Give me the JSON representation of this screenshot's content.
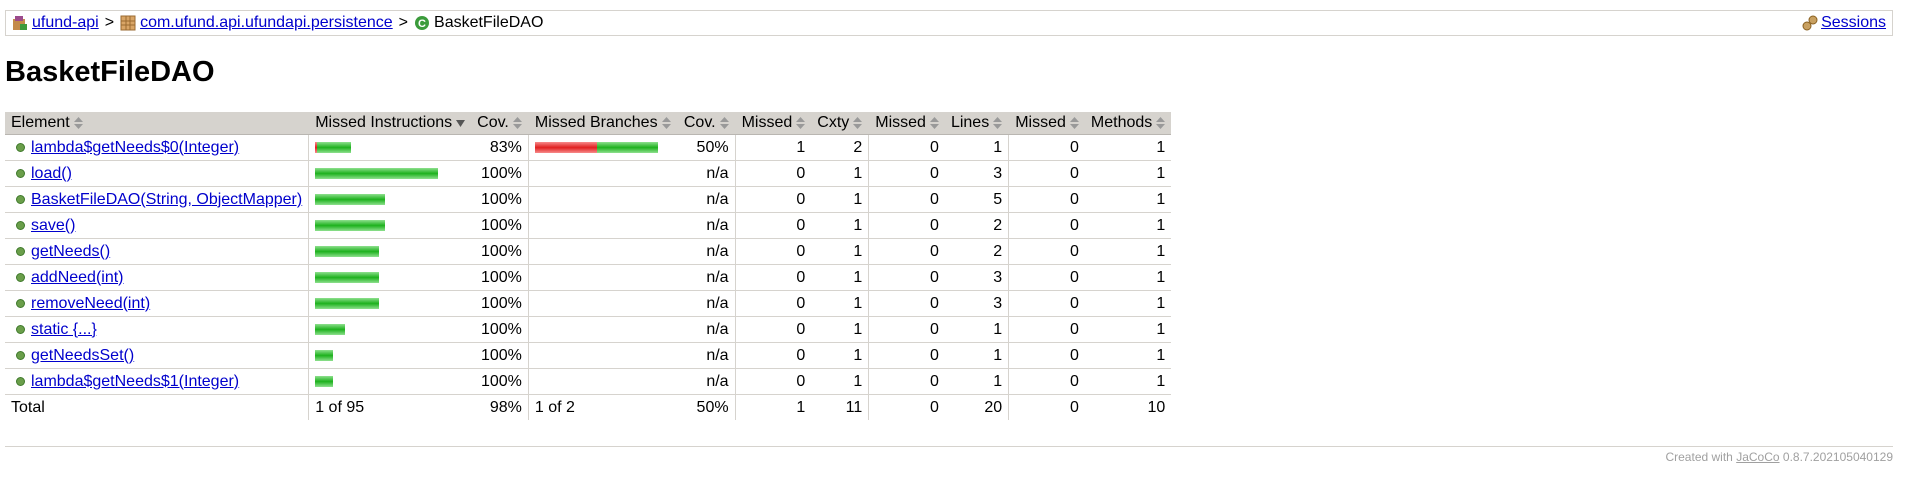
{
  "breadcrumb": {
    "items": [
      {
        "label": "ufund-api",
        "icon": "report-icon"
      },
      {
        "label": "com.ufund.api.ufundapi.persistence",
        "icon": "package-icon"
      }
    ],
    "separator": ">",
    "current": "BasketFileDAO",
    "current_icon": "class-icon",
    "sessions_label": "Sessions"
  },
  "page_title": "BasketFileDAO",
  "table": {
    "headers": [
      "Element",
      "Missed Instructions",
      "Cov.",
      "Missed Branches",
      "Cov.",
      "Missed",
      "Cxty",
      "Missed",
      "Lines",
      "Missed",
      "Methods"
    ],
    "rows": [
      {
        "element": "lambda$getNeeds$0(Integer)",
        "instr_missed_frac": 0.05,
        "instr_width_frac": 0.29,
        "instr_cov": "83%",
        "branch_missed_frac": 0.5,
        "branch_width_frac": 1.0,
        "branch_cov": "50%",
        "cxty_missed": "1",
        "cxty": "2",
        "lines_missed": "0",
        "lines": "1",
        "methods_missed": "0",
        "methods": "1"
      },
      {
        "element": "load()",
        "instr_missed_frac": 0,
        "instr_width_frac": 1.0,
        "instr_cov": "100%",
        "branch_missed_frac": null,
        "branch_width_frac": 0,
        "branch_cov": "n/a",
        "cxty_missed": "0",
        "cxty": "1",
        "lines_missed": "0",
        "lines": "3",
        "methods_missed": "0",
        "methods": "1"
      },
      {
        "element": "BasketFileDAO(String, ObjectMapper)",
        "instr_missed_frac": 0,
        "instr_width_frac": 0.57,
        "instr_cov": "100%",
        "branch_missed_frac": null,
        "branch_width_frac": 0,
        "branch_cov": "n/a",
        "cxty_missed": "0",
        "cxty": "1",
        "lines_missed": "0",
        "lines": "5",
        "methods_missed": "0",
        "methods": "1"
      },
      {
        "element": "save()",
        "instr_missed_frac": 0,
        "instr_width_frac": 0.57,
        "instr_cov": "100%",
        "branch_missed_frac": null,
        "branch_width_frac": 0,
        "branch_cov": "n/a",
        "cxty_missed": "0",
        "cxty": "1",
        "lines_missed": "0",
        "lines": "2",
        "methods_missed": "0",
        "methods": "1"
      },
      {
        "element": "getNeeds()",
        "instr_missed_frac": 0,
        "instr_width_frac": 0.52,
        "instr_cov": "100%",
        "branch_missed_frac": null,
        "branch_width_frac": 0,
        "branch_cov": "n/a",
        "cxty_missed": "0",
        "cxty": "1",
        "lines_missed": "0",
        "lines": "2",
        "methods_missed": "0",
        "methods": "1"
      },
      {
        "element": "addNeed(int)",
        "instr_missed_frac": 0,
        "instr_width_frac": 0.52,
        "instr_cov": "100%",
        "branch_missed_frac": null,
        "branch_width_frac": 0,
        "branch_cov": "n/a",
        "cxty_missed": "0",
        "cxty": "1",
        "lines_missed": "0",
        "lines": "3",
        "methods_missed": "0",
        "methods": "1"
      },
      {
        "element": "removeNeed(int)",
        "instr_missed_frac": 0,
        "instr_width_frac": 0.52,
        "instr_cov": "100%",
        "branch_missed_frac": null,
        "branch_width_frac": 0,
        "branch_cov": "n/a",
        "cxty_missed": "0",
        "cxty": "1",
        "lines_missed": "0",
        "lines": "3",
        "methods_missed": "0",
        "methods": "1"
      },
      {
        "element": "static {...}",
        "instr_missed_frac": 0,
        "instr_width_frac": 0.24,
        "instr_cov": "100%",
        "branch_missed_frac": null,
        "branch_width_frac": 0,
        "branch_cov": "n/a",
        "cxty_missed": "0",
        "cxty": "1",
        "lines_missed": "0",
        "lines": "1",
        "methods_missed": "0",
        "methods": "1"
      },
      {
        "element": "getNeedsSet()",
        "instr_missed_frac": 0,
        "instr_width_frac": 0.15,
        "instr_cov": "100%",
        "branch_missed_frac": null,
        "branch_width_frac": 0,
        "branch_cov": "n/a",
        "cxty_missed": "0",
        "cxty": "1",
        "lines_missed": "0",
        "lines": "1",
        "methods_missed": "0",
        "methods": "1"
      },
      {
        "element": "lambda$getNeeds$1(Integer)",
        "instr_missed_frac": 0,
        "instr_width_frac": 0.15,
        "instr_cov": "100%",
        "branch_missed_frac": null,
        "branch_width_frac": 0,
        "branch_cov": "n/a",
        "cxty_missed": "0",
        "cxty": "1",
        "lines_missed": "0",
        "lines": "1",
        "methods_missed": "0",
        "methods": "1"
      }
    ],
    "total": {
      "element": "Total",
      "instr": "1 of 95",
      "instr_cov": "98%",
      "branch": "1 of 2",
      "branch_cov": "50%",
      "cxty_missed": "1",
      "cxty": "11",
      "lines_missed": "0",
      "lines": "20",
      "methods_missed": "0",
      "methods": "10"
    }
  },
  "footer": {
    "prefix": "Created with",
    "link": "JaCoCo",
    "version": "0.8.7.202105040129"
  },
  "colors": {
    "header_bg": "#d6d3ce",
    "link": "#0000cc",
    "bar_green": "#1db11d",
    "bar_red": "#e02020"
  }
}
